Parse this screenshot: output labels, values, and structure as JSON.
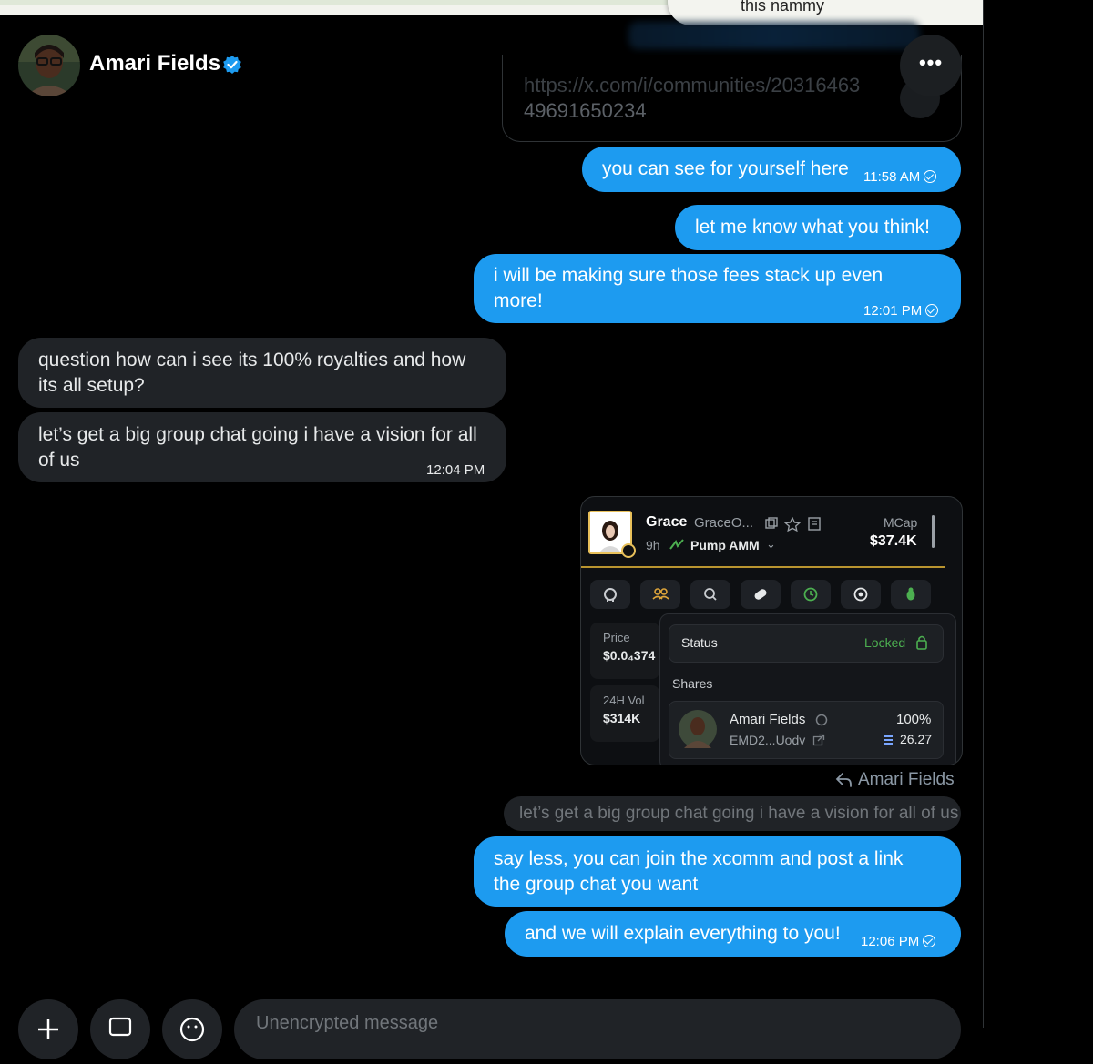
{
  "toast": {
    "text": "this nammy"
  },
  "header": {
    "name": "Amari Fields",
    "more_label": "•••",
    "avatar_icon": "user-avatar"
  },
  "link_card": {
    "url_line1": "https://x.com/i/communities/20316463",
    "url_line2": "49691650234"
  },
  "messages": [
    {
      "text": "you can see for yourself here",
      "time": "11:58 AM"
    },
    {
      "text": "let me know what you think!"
    },
    {
      "text_line1": "i will be making sure those fees stack up even",
      "text_line2": "more!",
      "time": "12:01 PM"
    },
    {
      "text_line1": "question how can i see its 100% royalties and how",
      "text_line2": "its all setup?"
    },
    {
      "text_line1": "let’s get a big group chat going i have a vision for all",
      "text_line2": "of us",
      "time": "12:04 PM"
    },
    {
      "text_line1": "say less, you can join the xcomm and post a link",
      "text_line2": "the group chat you want"
    },
    {
      "text": "and we will explain everything to you!",
      "time": "12:06 PM"
    }
  ],
  "screenshot": {
    "token_name": "Grace",
    "token_ticker": "GraceO...",
    "age": "9h",
    "pool": "Pump AMM",
    "mcap_label": "MCap",
    "mcap_value": "$37.4K",
    "price_label": "Price",
    "price_value": "$0.0₄374",
    "vol_label": "24H Vol",
    "vol_value": "$314K",
    "status_label": "Status",
    "status_value": "Locked",
    "shares_label": "Shares",
    "holder_name": "Amari Fields",
    "holder_addr": "EMD2...Uodv",
    "holder_pct": "100%",
    "holder_amount": "26.27",
    "accent_color": "#4caf50",
    "gold_color": "#b8942f"
  },
  "reply": {
    "label": "Amari Fields",
    "quoted_text": "let’s get a big group chat going i have a vision for all of us"
  },
  "composer": {
    "placeholder": "Unencrypted message"
  },
  "colors": {
    "outgoing": "#1d9bf0",
    "incoming": "#202327",
    "background": "#000000"
  }
}
